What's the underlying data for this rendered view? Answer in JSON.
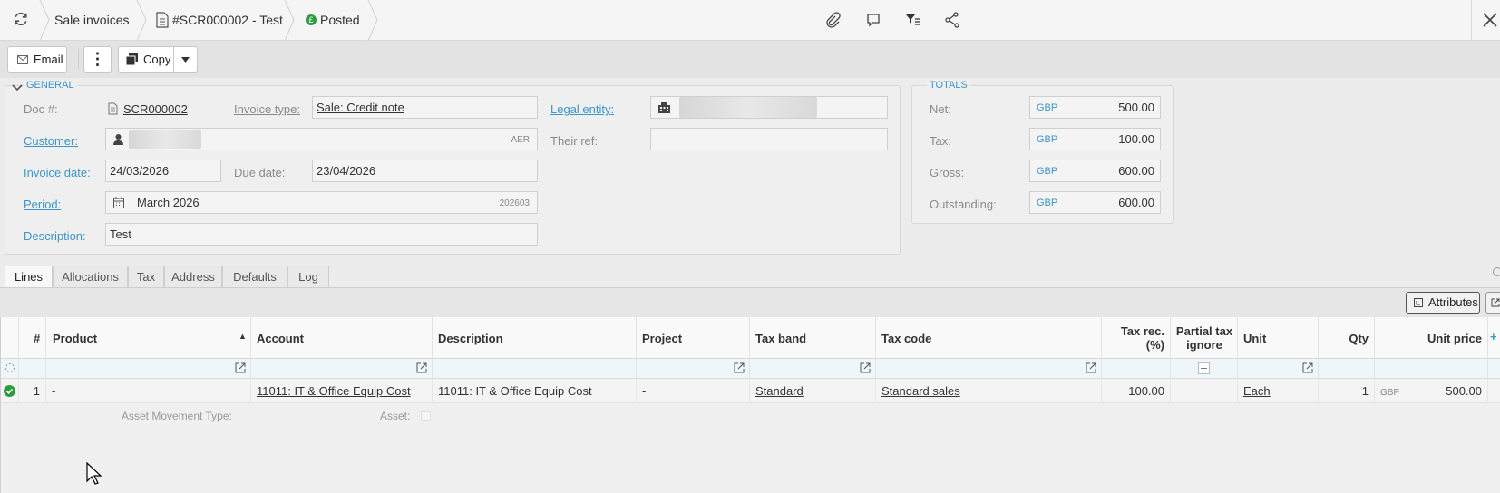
{
  "breadcrumb": {
    "module": "Sale invoices",
    "document": "#SCR000002 - Test",
    "status": "Posted"
  },
  "toolbar": {
    "email_label": "Email",
    "copy_label": "Copy"
  },
  "general": {
    "legend": "GENERAL",
    "doc_label": "Doc #:",
    "doc_value": "SCR000002",
    "invoice_type_label": "Invoice type:",
    "invoice_type_value": "Sale: Credit note",
    "legal_entity_label": "Legal entity:",
    "customer_label": "Customer:",
    "customer_code": "AER",
    "their_ref_label": "Their ref:",
    "invoice_date_label": "Invoice date:",
    "invoice_date_value": "24/03/2026",
    "due_date_label": "Due date:",
    "due_date_value": "23/04/2026",
    "period_label": "Period:",
    "period_value": "March 2026",
    "period_code": "202603",
    "description_label": "Description:",
    "description_value": "Test"
  },
  "totals": {
    "legend": "TOTALS",
    "rows": [
      {
        "label": "Net:",
        "currency": "GBP",
        "value": "500.00"
      },
      {
        "label": "Tax:",
        "currency": "GBP",
        "value": "100.00"
      },
      {
        "label": "Gross:",
        "currency": "GBP",
        "value": "600.00"
      },
      {
        "label": "Outstanding:",
        "currency": "GBP",
        "value": "600.00"
      }
    ]
  },
  "tabs": [
    "Lines",
    "Allocations",
    "Tax",
    "Address",
    "Defaults",
    "Log"
  ],
  "grid": {
    "attributes_label": "Attributes",
    "columns": [
      "#",
      "Product",
      "Account",
      "Description",
      "Project",
      "Tax band",
      "Tax code",
      "Tax rec. (%)",
      "Partial tax ignore",
      "Unit",
      "Qty",
      "Unit price"
    ],
    "row": {
      "num": "1",
      "product": "-",
      "account": "11011: IT & Office Equip Cost",
      "description": "11011: IT & Office Equip Cost",
      "project": "-",
      "tax_band": "Standard",
      "tax_code": "Standard sales",
      "tax_rec": "100.00",
      "unit": "Each",
      "qty": "1",
      "currency": "GBP",
      "unit_price": "500.00"
    },
    "sub": {
      "asset_movement_label": "Asset Movement Type:",
      "asset_label": "Asset:"
    }
  }
}
